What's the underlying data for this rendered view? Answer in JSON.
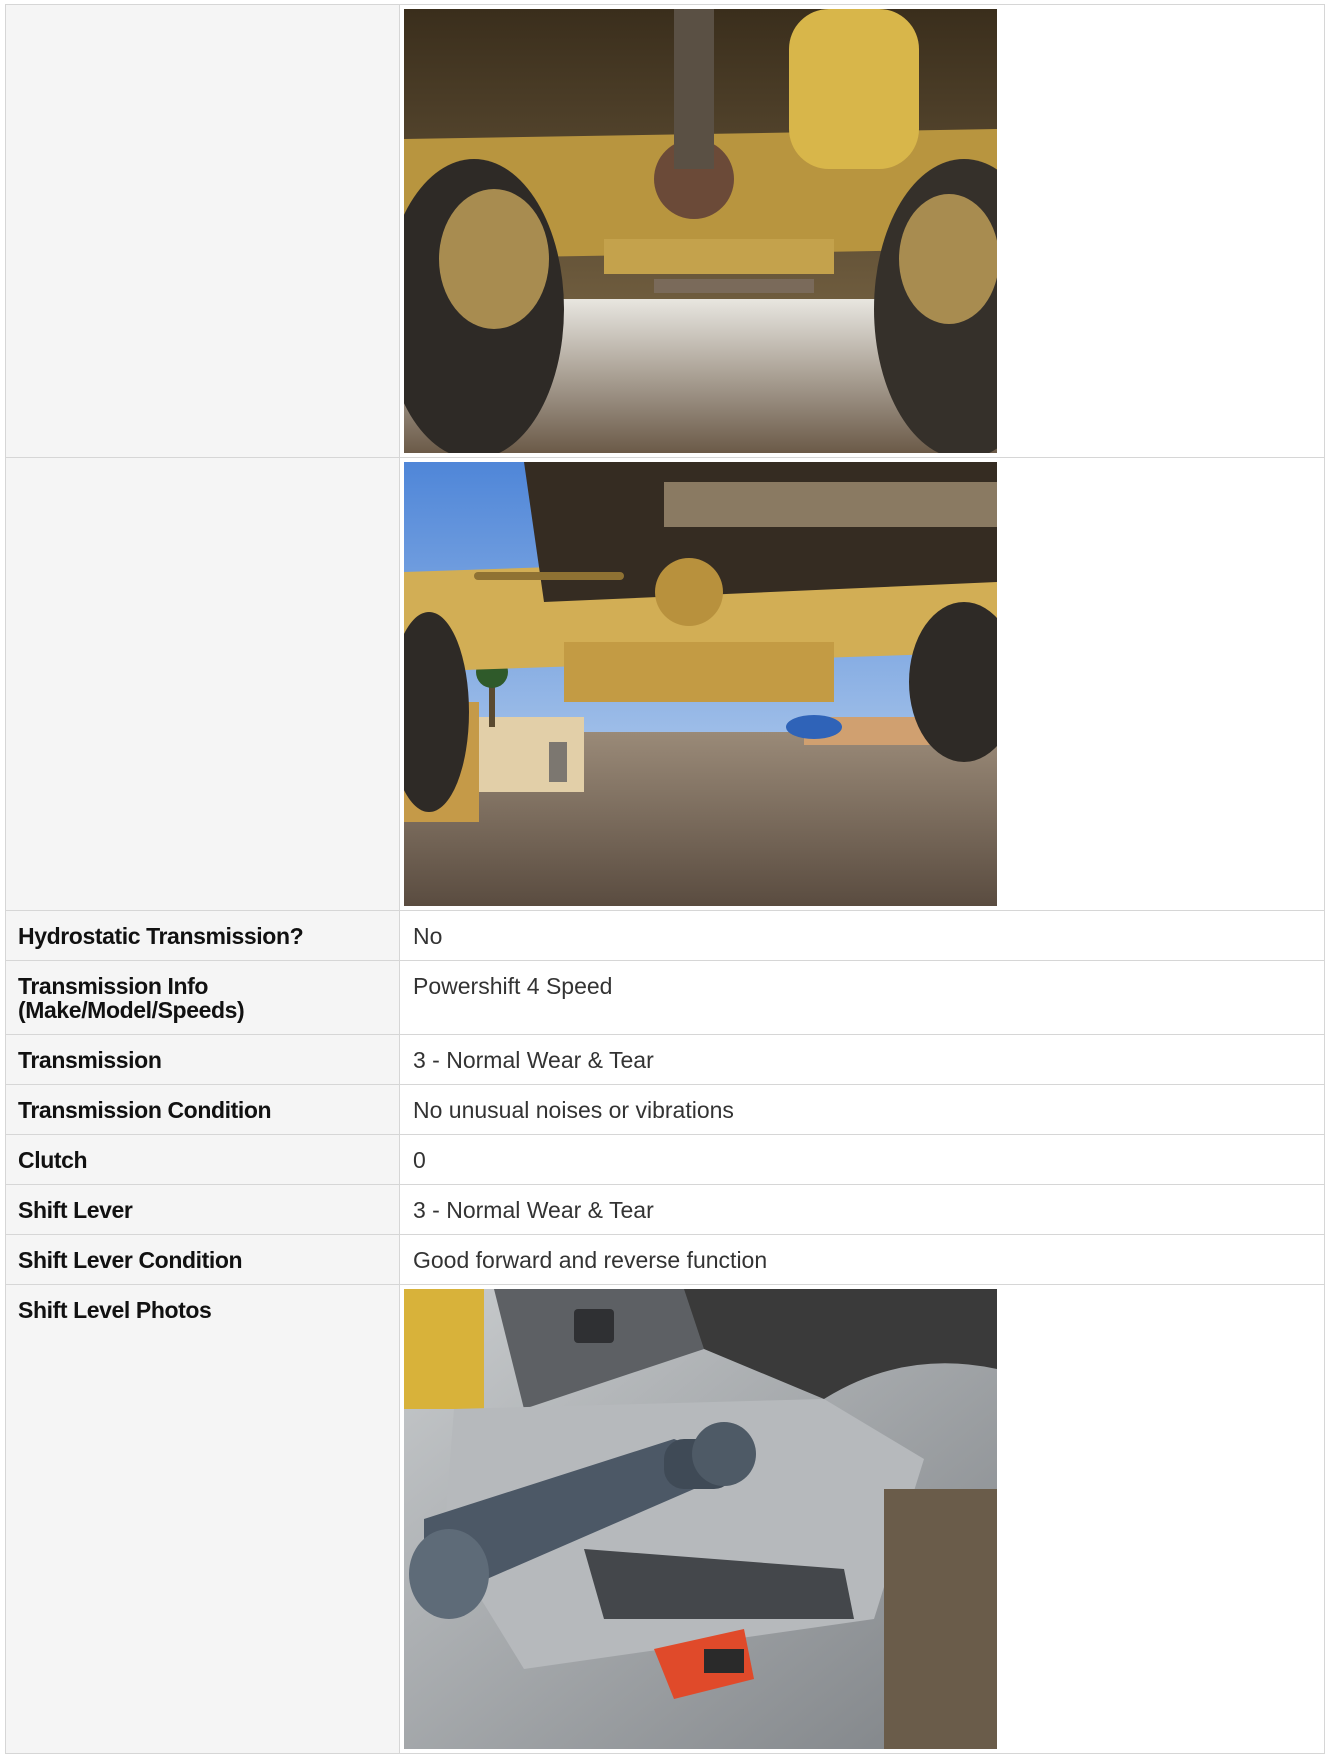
{
  "rows": [
    {
      "label": "Hydrostatic Transmission?",
      "value": "No"
    },
    {
      "label": "Transmission Info (Make/Model/Speeds)",
      "value": "Powershift 4 Speed"
    },
    {
      "label": "Transmission",
      "value": "3 - Normal Wear & Tear"
    },
    {
      "label": "Transmission Condition",
      "value": "No unusual noises or vibrations"
    },
    {
      "label": "Clutch",
      "value": "0"
    },
    {
      "label": "Shift Lever",
      "value": "3 - Normal Wear & Tear"
    },
    {
      "label": "Shift Lever Condition",
      "value": "Good forward and reverse function"
    },
    {
      "label": "Shift Level Photos",
      "value": ""
    }
  ],
  "photos": {
    "undercarriage_front": "photo-undercarriage-axle",
    "undercarriage_rear": "photo-rear-axle",
    "shift_lever": "photo-shift-lever"
  },
  "colors": {
    "label_bg": "#f5f5f5",
    "border": "#d6d6d6",
    "machine_yellow": "#c9a24a"
  }
}
